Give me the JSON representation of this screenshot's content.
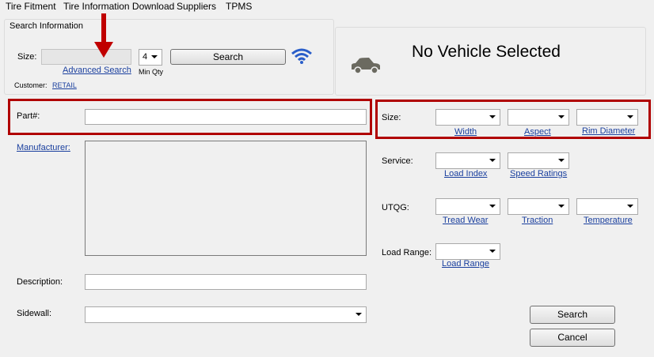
{
  "menu": [
    "Tire Fitment",
    "Tire Information Download",
    "Suppliers",
    "TPMS"
  ],
  "search_info": {
    "title": "Search Information",
    "size_label": "Size:",
    "size_value": "",
    "min_qty_value": "4",
    "min_qty_label": "Min Qty",
    "search_button": "Search",
    "advanced_search": "Advanced Search",
    "customer_label": "Customer:",
    "customer_value": "RETAIL"
  },
  "vehicle": {
    "status": "No Vehicle Selected"
  },
  "left": {
    "part_label": "Part#:",
    "part_value": "",
    "manufacturer_link": "Manufacturer:",
    "description_label": "Description:",
    "description_value": "",
    "sidewall_label": "Sidewall:",
    "sidewall_value": ""
  },
  "right": {
    "size_label": "Size:",
    "width_link": "Width",
    "aspect_link": "Aspect",
    "rim_link": "Rim Diameter",
    "service_label": "Service:",
    "load_index_link": "Load Index",
    "speed_link": "Speed Ratings",
    "utqg_label": "UTQG:",
    "tread_link": "Tread Wear",
    "traction_link": "Traction",
    "temperature_link": "Temperature",
    "load_range_label": "Load Range:",
    "load_range_link": "Load Range"
  },
  "buttons": {
    "search": "Search",
    "cancel": "Cancel"
  },
  "colors": {
    "highlight": "#b00000",
    "link": "#1a3f9e",
    "wifi": "#2a5ec9",
    "car": "#6b6a60"
  }
}
